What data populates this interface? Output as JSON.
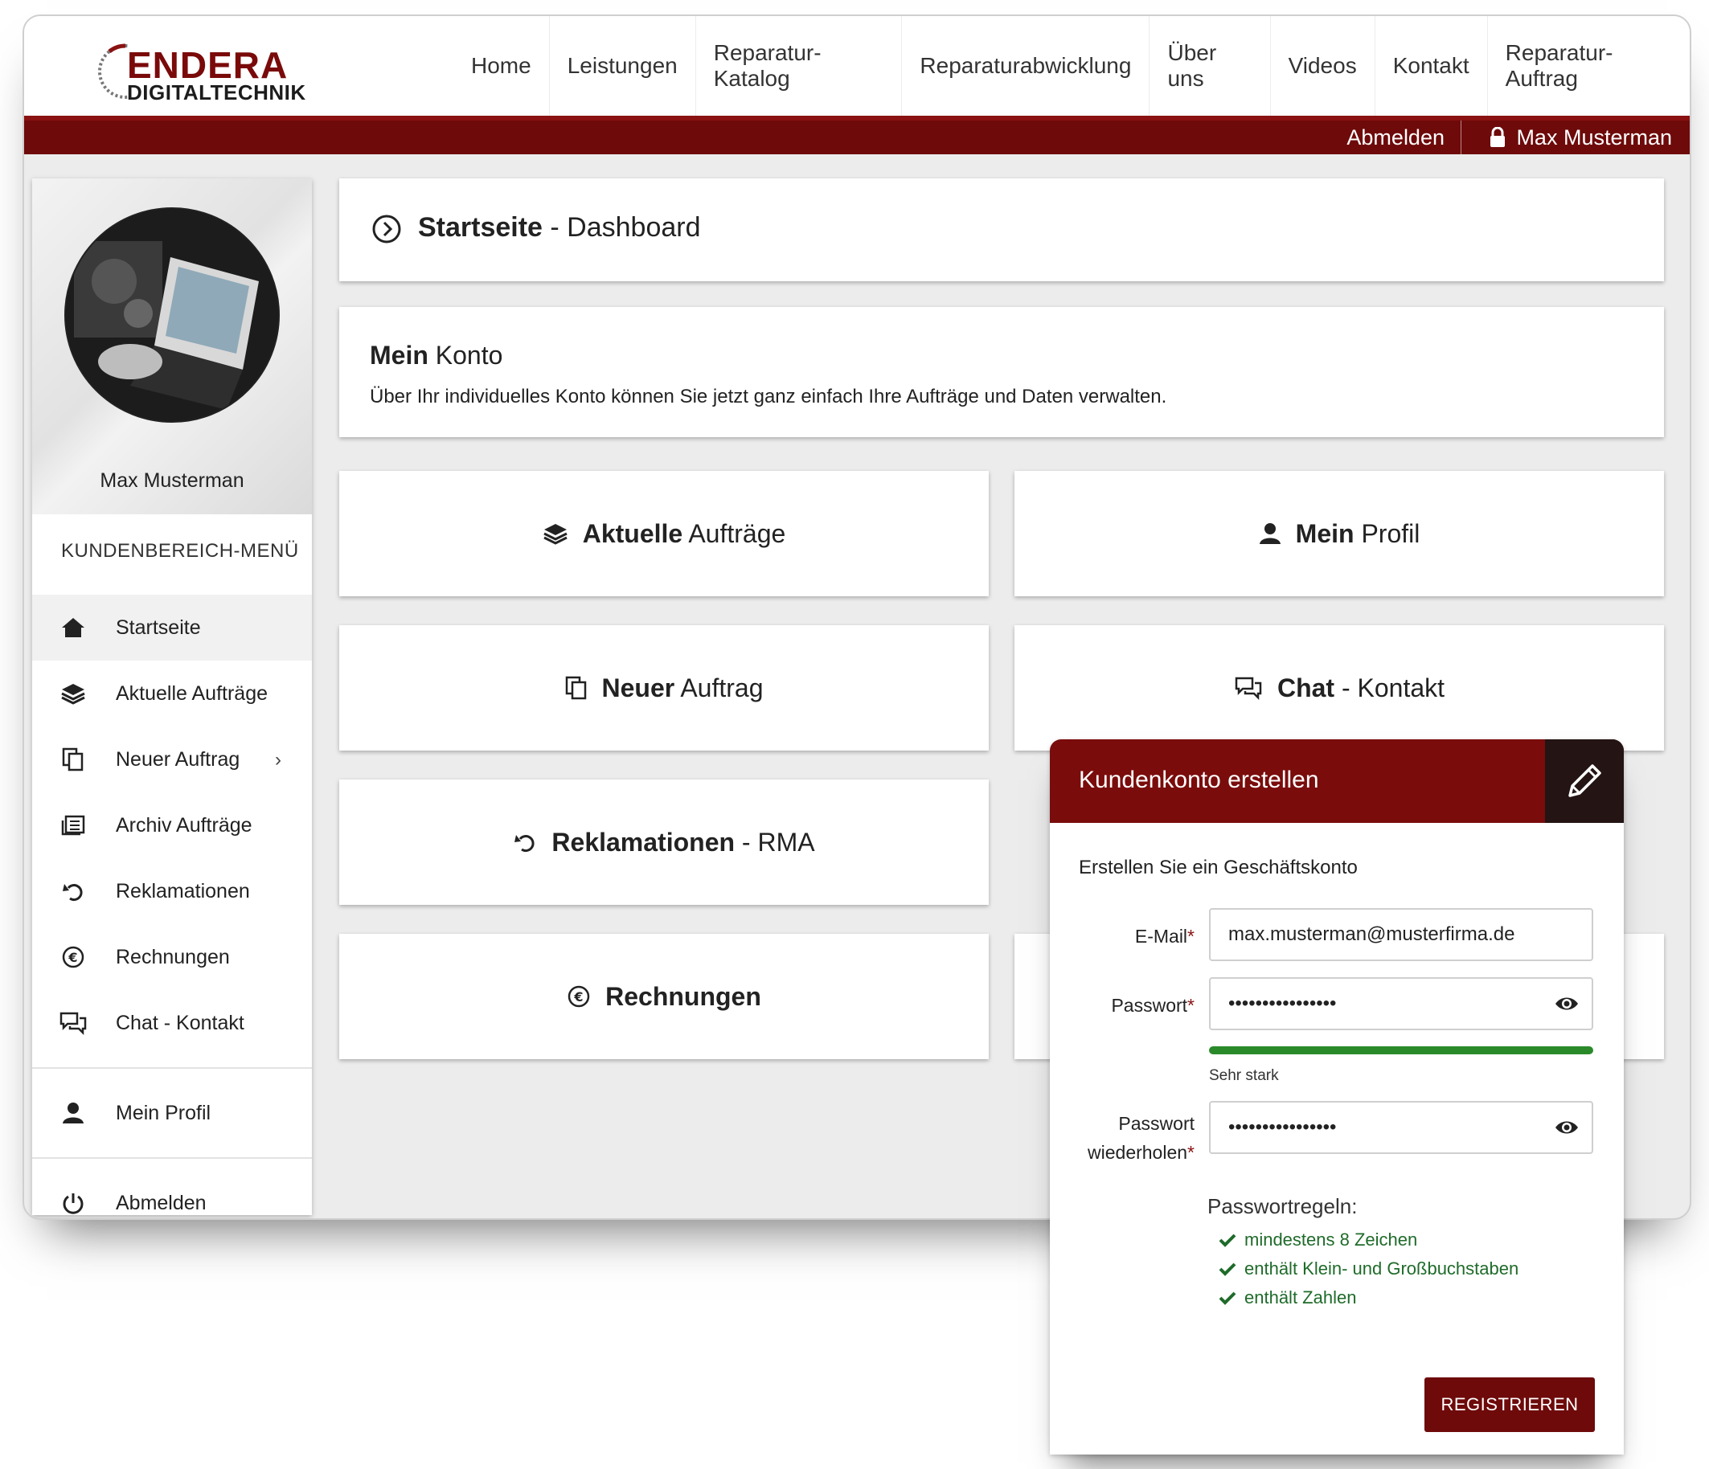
{
  "brand": {
    "line1": "ENDERA",
    "line2": "DIGITALTECHNIK"
  },
  "nav": [
    "Home",
    "Leistungen",
    "Reparatur-Katalog",
    "Reparaturabwicklung",
    "Über uns",
    "Videos",
    "Kontakt",
    "Reparatur-Auftrag"
  ],
  "topbar": {
    "logout": "Abmelden",
    "user": "Max Musterman"
  },
  "sidebar": {
    "name": "Max Musterman",
    "menu_title": "KUNDENBEREICH-MENÜ",
    "items": [
      {
        "label": "Startseite",
        "icon": "home-icon"
      },
      {
        "label": "Aktuelle Aufträge",
        "icon": "layers-icon"
      },
      {
        "label": "Neuer Auftrag",
        "icon": "copy-icon"
      },
      {
        "label": "Archiv Aufträge",
        "icon": "archive-icon"
      },
      {
        "label": "Reklamationen",
        "icon": "undo-icon"
      },
      {
        "label": "Rechnungen",
        "icon": "euro-icon"
      },
      {
        "label": "Chat - Kontakt",
        "icon": "chat-icon"
      },
      {
        "label": "Mein Profil",
        "icon": "user-icon"
      },
      {
        "label": "Abmelden",
        "icon": "power-icon"
      }
    ]
  },
  "page_title": {
    "bold": "Startseite",
    "rest": " - Dashboard"
  },
  "konto": {
    "bold": "Mein",
    "rest": " Konto",
    "desc": "Über Ihr individuelles Konto können Sie jetzt ganz einfach Ihre Aufträge und Daten verwalten."
  },
  "tiles": {
    "aktuelle": {
      "bold": "Aktuelle",
      "rest": " Aufträge"
    },
    "profil": {
      "bold": "Mein",
      "rest": " Profil"
    },
    "neuer": {
      "bold": "Neuer",
      "rest": " Auftrag"
    },
    "chat": {
      "bold": "Chat",
      "rest": " - Kontakt"
    },
    "rma": {
      "bold": "Reklamationen",
      "rest": " - RMA"
    },
    "rechnungen": {
      "bold": "Rechnungen",
      "rest": ""
    }
  },
  "card": {
    "title": "Kundenkonto erstellen",
    "subtitle": "Erstellen Sie ein Geschäftskonto",
    "email_label": "E-Mail",
    "email_value": "max.musterman@musterfirma.de",
    "password_label": "Passwort",
    "password_value": "••••••••••••••••",
    "strength_text": "Sehr stark",
    "strength_level": 1.0,
    "repeat_label_1": "Passwort",
    "repeat_label_2": "wiederholen",
    "repeat_value": "••••••••••••••••",
    "rules_title": "Passwortregeln:",
    "rules": [
      "mindestens 8 Zeichen",
      "enthält Klein- und Großbuchstaben",
      "enthält Zahlen"
    ],
    "submit": "REGISTRIEREN"
  },
  "colors": {
    "brand": "#6e0a0a",
    "success": "#2a8a2a"
  }
}
